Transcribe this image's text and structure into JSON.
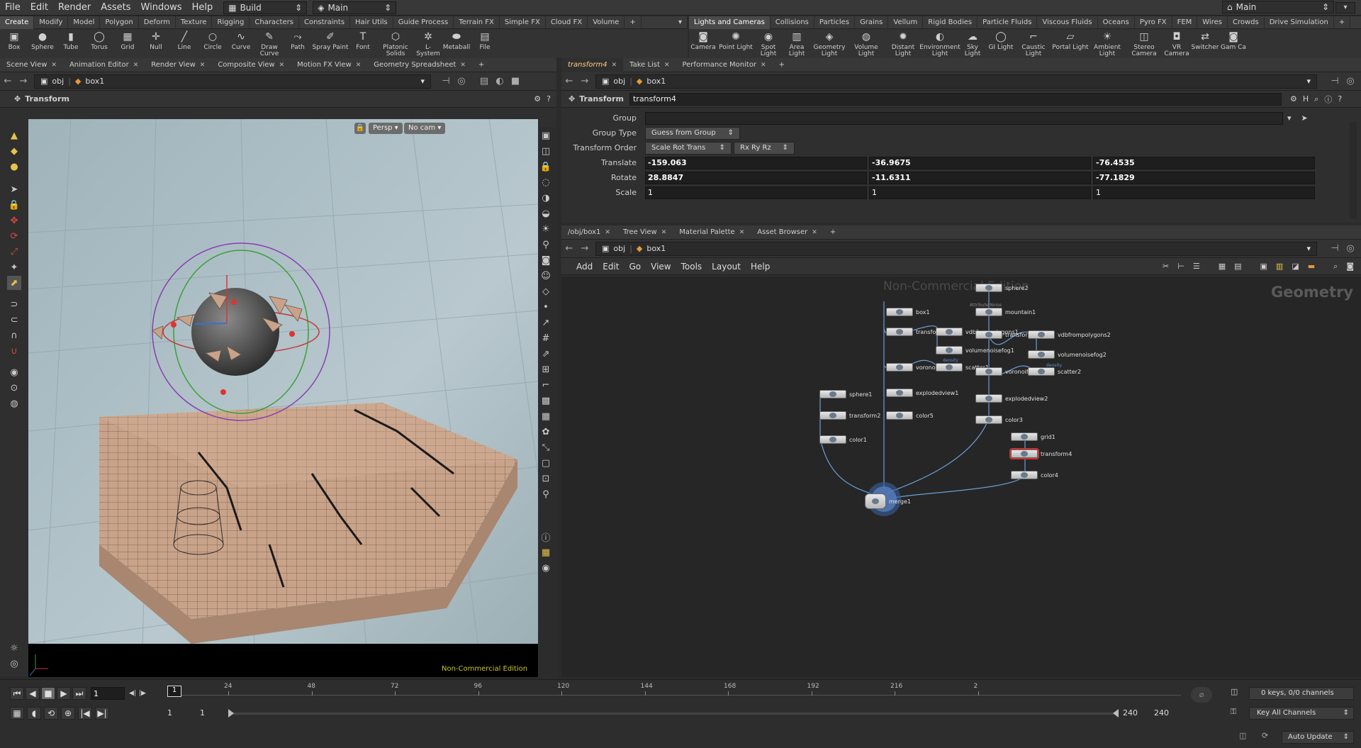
{
  "menubar": {
    "items": [
      "File",
      "Edit",
      "Render",
      "Assets",
      "Windows",
      "Help"
    ],
    "desktop": "Build",
    "context": "Main",
    "right_context": "Main"
  },
  "shelf_left": {
    "tabs": [
      "Create",
      "Modify",
      "Model",
      "Polygon",
      "Deform",
      "Texture",
      "Rigging",
      "Characters",
      "Constraints",
      "Hair Utils",
      "Guide Process",
      "Terrain FX",
      "Simple FX",
      "Cloud FX",
      "Volume"
    ],
    "tools": [
      {
        "label": "Box",
        "icon": "box-icon"
      },
      {
        "label": "Sphere",
        "icon": "sphere-icon"
      },
      {
        "label": "Tube",
        "icon": "tube-icon"
      },
      {
        "label": "Torus",
        "icon": "torus-icon"
      },
      {
        "label": "Grid",
        "icon": "grid-icon"
      },
      {
        "label": "Null",
        "icon": "null-icon"
      },
      {
        "label": "Line",
        "icon": "line-icon"
      },
      {
        "label": "Circle",
        "icon": "circle-icon"
      },
      {
        "label": "Curve",
        "icon": "curve-icon"
      },
      {
        "label": "Draw Curve",
        "icon": "draw-curve-icon"
      },
      {
        "label": "Path",
        "icon": "path-icon"
      },
      {
        "label": "Spray Paint",
        "icon": "spray-paint-icon"
      },
      {
        "label": "Font",
        "icon": "font-icon"
      },
      {
        "label": "Platonic Solids",
        "icon": "platonic-icon"
      },
      {
        "label": "L-System",
        "icon": "lsystem-icon"
      },
      {
        "label": "Metaball",
        "icon": "metaball-icon"
      },
      {
        "label": "File",
        "icon": "file-icon"
      }
    ]
  },
  "shelf_right": {
    "tabs": [
      "Lights and Cameras",
      "Collisions",
      "Particles",
      "Grains",
      "Vellum",
      "Rigid Bodies",
      "Particle Fluids",
      "Viscous Fluids",
      "Oceans",
      "Pyro FX",
      "FEM",
      "Wires",
      "Crowds",
      "Drive Simulation"
    ],
    "tools": [
      {
        "label": "Camera",
        "icon": "camera-icon"
      },
      {
        "label": "Point Light",
        "icon": "point-light-icon"
      },
      {
        "label": "Spot Light",
        "icon": "spot-light-icon"
      },
      {
        "label": "Area Light",
        "icon": "area-light-icon"
      },
      {
        "label": "Geometry Light",
        "icon": "geometry-light-icon"
      },
      {
        "label": "Volume Light",
        "icon": "volume-light-icon"
      },
      {
        "label": "Distant Light",
        "icon": "distant-light-icon"
      },
      {
        "label": "Environment Light",
        "icon": "environment-light-icon"
      },
      {
        "label": "Sky Light",
        "icon": "sky-light-icon"
      },
      {
        "label": "GI Light",
        "icon": "gi-light-icon"
      },
      {
        "label": "Caustic Light",
        "icon": "caustic-light-icon"
      },
      {
        "label": "Portal Light",
        "icon": "portal-light-icon"
      },
      {
        "label": "Ambient Light",
        "icon": "ambient-light-icon"
      },
      {
        "label": "Stereo Camera",
        "icon": "stereo-camera-icon"
      },
      {
        "label": "VR Camera",
        "icon": "vr-camera-icon"
      },
      {
        "label": "Switcher",
        "icon": "switcher-icon"
      },
      {
        "label": "Gam Ca",
        "icon": "gamepad-camera-icon"
      }
    ]
  },
  "viewer": {
    "tabs": [
      "Scene View",
      "Animation Editor",
      "Render View",
      "Composite View",
      "Motion FX View",
      "Geometry Spreadsheet"
    ],
    "path_root": "obj",
    "path_node": "box1",
    "tool_title": "Transform",
    "persp": "Persp",
    "cam": "No cam",
    "watermark": "Non-Commercial Edition"
  },
  "params": {
    "tabs": [
      "transform4",
      "Take List",
      "Performance Monitor"
    ],
    "path_root": "obj",
    "path_node": "box1",
    "node_type": "Transform",
    "node_name": "transform4",
    "group_label": "Group",
    "group_value": "",
    "group_type_label": "Group Type",
    "group_type_value": "Guess from Group",
    "transform_order_label": "Transform Order",
    "transform_order_value": "Scale Rot Trans",
    "rot_order_value": "Rx Ry Rz",
    "translate_label": "Translate",
    "translate": [
      "-159.063",
      "-36.9675",
      "-76.4535"
    ],
    "rotate_label": "Rotate",
    "rotate": [
      "28.8847",
      "-11.6311",
      "-77.1829"
    ],
    "scale_label": "Scale",
    "scale": [
      "1",
      "1",
      "1"
    ]
  },
  "network": {
    "tabs": [
      "/obj/box1",
      "Tree View",
      "Material Palette",
      "Asset Browser"
    ],
    "path_root": "obj",
    "path_node": "box1",
    "menu": [
      "Add",
      "Edit",
      "Go",
      "View",
      "Tools",
      "Layout",
      "Help"
    ],
    "watermark": "Non-Commercial Edition",
    "context_label": "Geometry",
    "nodes": [
      "sphere2",
      "mountain1",
      "box1",
      "transform1",
      "vdbfrompolygons1",
      "transform3",
      "vdbfrompolygons2",
      "volumenoisefog1",
      "volumenoisefog2",
      "voronoifrac",
      "scatter1",
      "voronoifrac",
      "scatter2",
      "sphere1",
      "explodedview1",
      "explodedview2",
      "transform2",
      "color5",
      "color3",
      "color1",
      "grid1",
      "transform4",
      "color4",
      "merge1"
    ],
    "annotations": {
      "attribute_noise": "Attribute Noise",
      "density": "density"
    }
  },
  "timeline": {
    "current_frame": "1",
    "frame_marker": "1",
    "ticks": [
      "24",
      "48",
      "72",
      "96",
      "120",
      "144",
      "168",
      "192",
      "216",
      "2"
    ],
    "range_start": "1",
    "range_start2": "1",
    "range_end": "240",
    "range_end2": "240",
    "keys_info": "0 keys, 0/0 channels",
    "key_all": "Key All Channels",
    "auto_update": "Auto Update"
  }
}
